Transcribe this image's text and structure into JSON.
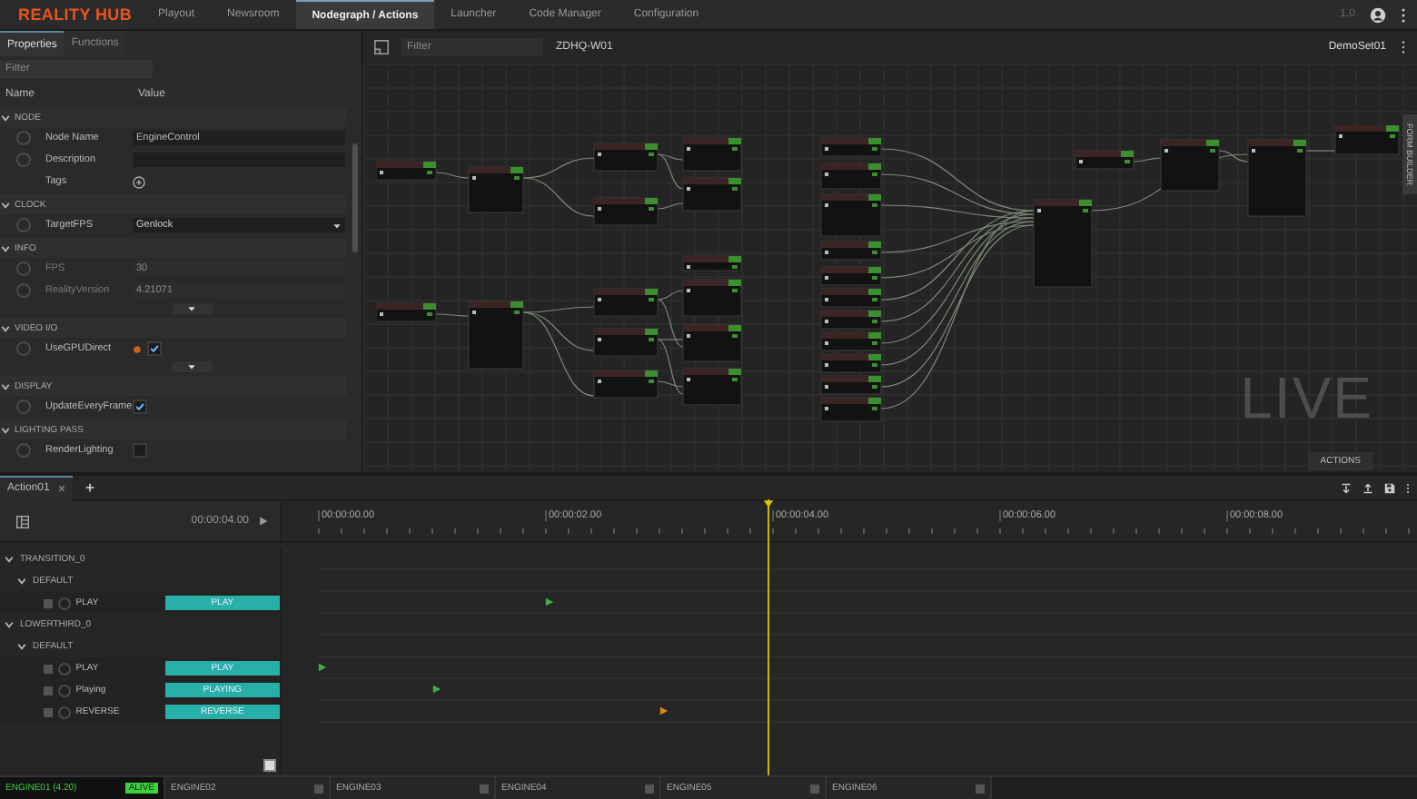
{
  "app": {
    "logo": "REALITY HUB",
    "version": "1.0"
  },
  "nav_tabs": [
    {
      "label": "Playout",
      "selected": false
    },
    {
      "label": "Newsroom",
      "selected": false
    },
    {
      "label": "Nodegraph / Actions",
      "selected": true
    },
    {
      "label": "Launcher",
      "selected": false
    },
    {
      "label": "Code Manager",
      "selected": false
    },
    {
      "label": "Configuration",
      "selected": false
    }
  ],
  "properties_panel": {
    "tabs": [
      {
        "label": "Properties",
        "selected": true
      },
      {
        "label": "Functions",
        "selected": false
      }
    ],
    "filter": {
      "placeholder": "Filter"
    },
    "columns": [
      "Name",
      "Value"
    ],
    "sections": [
      {
        "title": "NODE",
        "expanded": true,
        "has_more": false,
        "rows": [
          {
            "kind": "text",
            "label": "Node Name",
            "value": "EngineControl",
            "disabled": false
          },
          {
            "kind": "text",
            "label": "Description",
            "disabled": false
          },
          {
            "kind": "tags",
            "label": "Tags"
          }
        ]
      },
      {
        "title": "CLOCK",
        "expanded": true,
        "has_more": false,
        "rows": [
          {
            "kind": "select",
            "label": "TargetFPS",
            "value": "Genlock"
          }
        ]
      },
      {
        "title": "INFO",
        "expanded": true,
        "has_more": true,
        "rows": [
          {
            "kind": "text",
            "label": "FPS",
            "value": "30",
            "disabled": true
          },
          {
            "kind": "text",
            "label": "RealityVersion",
            "value": "4.21071",
            "disabled": true
          }
        ]
      },
      {
        "title": "VIDEO I/O",
        "expanded": true,
        "has_more": true,
        "rows": [
          {
            "kind": "checkbox",
            "label": "UseGPUDirect",
            "checked": true,
            "warning": true
          }
        ]
      },
      {
        "title": "DISPLAY",
        "expanded": true,
        "has_more": false,
        "rows": [
          {
            "kind": "checkbox",
            "label": "UpdateEveryFrame",
            "checked": true,
            "warning": false
          }
        ]
      },
      {
        "title": "LIGHTING PASS",
        "expanded": true,
        "has_more": false,
        "rows": [
          {
            "kind": "checkbox",
            "label": "RenderLighting",
            "checked": false,
            "warning": false
          }
        ]
      }
    ]
  },
  "graph": {
    "filter": {
      "placeholder": "Filter"
    },
    "path": "ZDHQ-W01",
    "set": "DemoSet01",
    "side_tab": "FORM BUILDER",
    "live_label": "LIVE",
    "actions_button": "ACTIONS"
  },
  "actions": {
    "tabs": [
      {
        "label": "Action01",
        "selected": true
      }
    ],
    "current_time": "00:00:04.00",
    "playhead": {
      "level": 0.41
    },
    "ruler": [
      "00:00:00.00",
      "00:00:02.00",
      "00:00:04.00",
      "00:00:06.00",
      "00:00:08.00"
    ],
    "tracks": [
      {
        "label": "TRANSITION_0",
        "expanded": true,
        "children": [
          {
            "label": "DEFAULT",
            "expanded": true,
            "children": [
              {
                "label": "PLAY",
                "button": "PLAY",
                "checked": false,
                "keyframe": {
                  "level": 0.207,
                  "color": "#3fae4a"
                }
              }
            ]
          }
        ]
      },
      {
        "label": "LOWERTHIRD_0",
        "expanded": true,
        "children": [
          {
            "label": "DEFAULT",
            "expanded": true,
            "children": [
              {
                "label": "PLAY",
                "button": "PLAY",
                "checked": false,
                "keyframe": {
                  "level": 0.0,
                  "color": "#3fae4a"
                }
              },
              {
                "label": "Playing",
                "button": "PLAYING",
                "checked": false,
                "keyframe": {
                  "level": 0.104,
                  "color": "#3fae4a"
                }
              },
              {
                "label": "REVERSE",
                "button": "REVERSE",
                "checked": false,
                "keyframe": {
                  "level": 0.31,
                  "color": "#e08a1a"
                }
              }
            ]
          }
        ]
      }
    ]
  },
  "status_bar": {
    "engines": [
      {
        "label": "ENGINE01 (4.20)",
        "status": "ALIVE",
        "selected": true
      },
      {
        "label": "ENGINE02",
        "selected": false
      },
      {
        "label": "ENGINE03",
        "selected": false
      },
      {
        "label": "ENGINE04",
        "selected": false
      },
      {
        "label": "ENGINE05",
        "selected": false
      },
      {
        "label": "ENGINE06",
        "selected": false
      }
    ]
  }
}
